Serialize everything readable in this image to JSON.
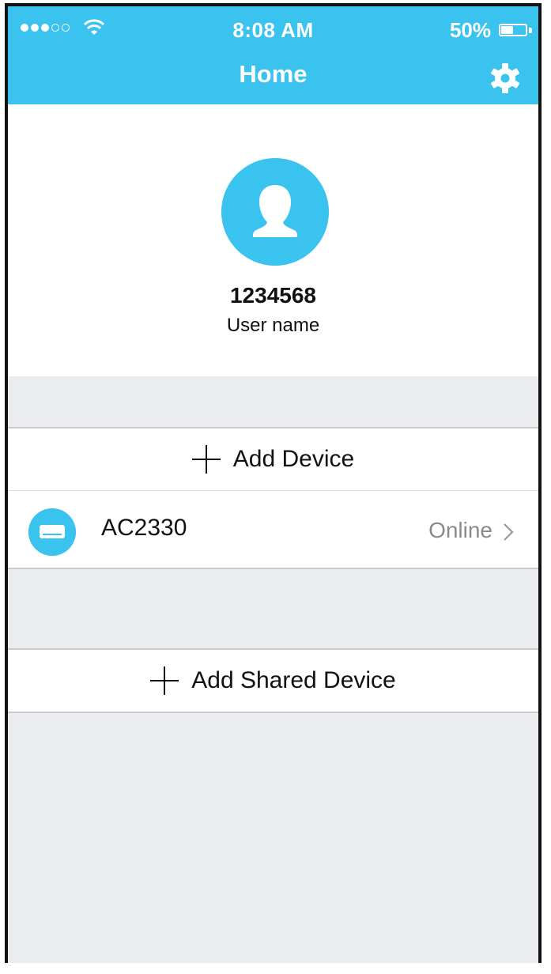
{
  "status_bar": {
    "time": "8:08 AM",
    "battery_percent": "50%",
    "battery_level": 0.5,
    "signal_bars_filled": 3,
    "signal_bars_total": 5,
    "icons": [
      "signal-dots-icon",
      "wifi-icon",
      "battery-icon"
    ]
  },
  "nav": {
    "title": "Home",
    "settings_icon": "gear-icon"
  },
  "profile": {
    "user_id": "1234568",
    "user_name": "User name",
    "avatar_icon": "user-silhouette-icon"
  },
  "actions": {
    "add_device_label": "Add Device",
    "add_shared_device_label": "Add Shared Device",
    "plus_icon": "plus-icon"
  },
  "devices": [
    {
      "name": "AC2330",
      "status": "Online",
      "icon": "air-conditioner-icon"
    }
  ],
  "colors": {
    "accent": "#39c3ee",
    "background": "#ebecf0",
    "status_text": "#8a8a8a"
  }
}
